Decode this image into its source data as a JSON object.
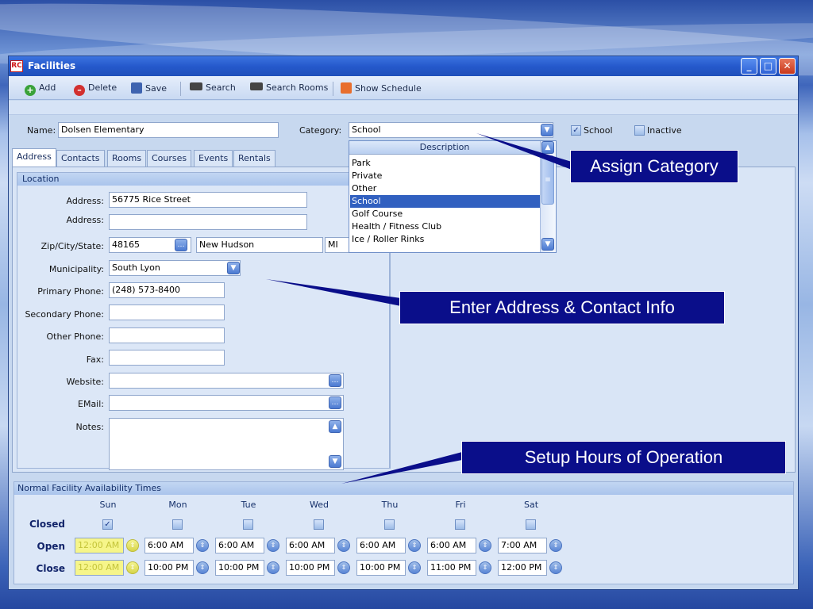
{
  "window": {
    "title": "Facilities",
    "logo": "RC"
  },
  "toolbar": {
    "add": "Add",
    "delete": "Delete",
    "save": "Save",
    "search": "Search",
    "search_rooms": "Search Rooms",
    "show_schedule": "Show Schedule"
  },
  "form": {
    "name_label": "Name:",
    "name_value": "Dolsen Elementary",
    "category_label": "Category:",
    "category_value": "School",
    "school_label": "School",
    "inactive_label": "Inactive"
  },
  "tabs": [
    "Address",
    "Contacts",
    "Rooms",
    "Courses",
    "Events",
    "Rentals"
  ],
  "location": {
    "header": "Location",
    "address_label": "Address:",
    "address1": "56775 Rice Street",
    "address2": "",
    "zip_label": "Zip/City/State:",
    "zip": "48165",
    "city": "New Hudson",
    "state": "MI",
    "municipality_label": "Municipality:",
    "municipality": "South Lyon",
    "primary_phone_label": "Primary Phone:",
    "primary_phone": "(248) 573-8400",
    "secondary_phone_label": "Secondary Phone:",
    "other_phone_label": "Other Phone:",
    "fax_label": "Fax:",
    "website_label": "Website:",
    "email_label": "EMail:",
    "notes_label": "Notes:"
  },
  "category_dropdown": {
    "header": "Description",
    "items": [
      "Park",
      "Private",
      "Other",
      "School",
      "Golf Course",
      "Health / Fitness Club",
      "Ice / Roller Rinks"
    ],
    "selected": "School"
  },
  "hours": {
    "header": "Normal Facility Availability Times",
    "days": [
      "Sun",
      "Mon",
      "Tue",
      "Wed",
      "Thu",
      "Fri",
      "Sat"
    ],
    "closed_label": "Closed",
    "open_label": "Open",
    "close_label": "Close",
    "closed": [
      true,
      false,
      false,
      false,
      false,
      false,
      false
    ],
    "open": [
      "12:00 AM",
      "6:00 AM",
      "6:00 AM",
      "6:00 AM",
      "6:00 AM",
      "6:00 AM",
      "7:00 AM"
    ],
    "close": [
      "12:00 AM",
      "10:00 PM",
      "10:00 PM",
      "10:00 PM",
      "10:00 PM",
      "11:00 PM",
      "12:00 PM"
    ]
  },
  "callouts": {
    "category": "Assign Category",
    "address": "Enter Address & Contact Info",
    "hours": "Setup Hours of Operation"
  }
}
